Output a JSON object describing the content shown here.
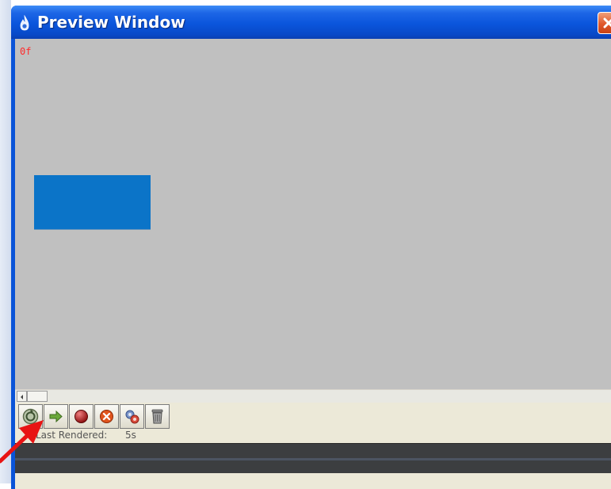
{
  "window": {
    "title": "Preview Window",
    "title_icon": "flame-icon",
    "close_icon": "close-icon",
    "accent_color": "#0a55dc"
  },
  "canvas": {
    "frame_label": "0f",
    "background_color": "#c0c0c0",
    "shape_color": "#0b74c8"
  },
  "toolbar": {
    "buttons": [
      {
        "name": "refresh-button",
        "icon": "refresh-icon"
      },
      {
        "name": "play-button",
        "icon": "arrow-right-icon"
      },
      {
        "name": "record-button",
        "icon": "record-icon"
      },
      {
        "name": "stop-button",
        "icon": "stop-icon"
      },
      {
        "name": "settings-button",
        "icon": "settings-icon"
      },
      {
        "name": "clear-cache-button",
        "icon": "trash-icon"
      }
    ]
  },
  "status": {
    "label": "Last Rendered:",
    "value": "5s"
  },
  "annotation": {
    "arrow_color": "#e81414"
  }
}
